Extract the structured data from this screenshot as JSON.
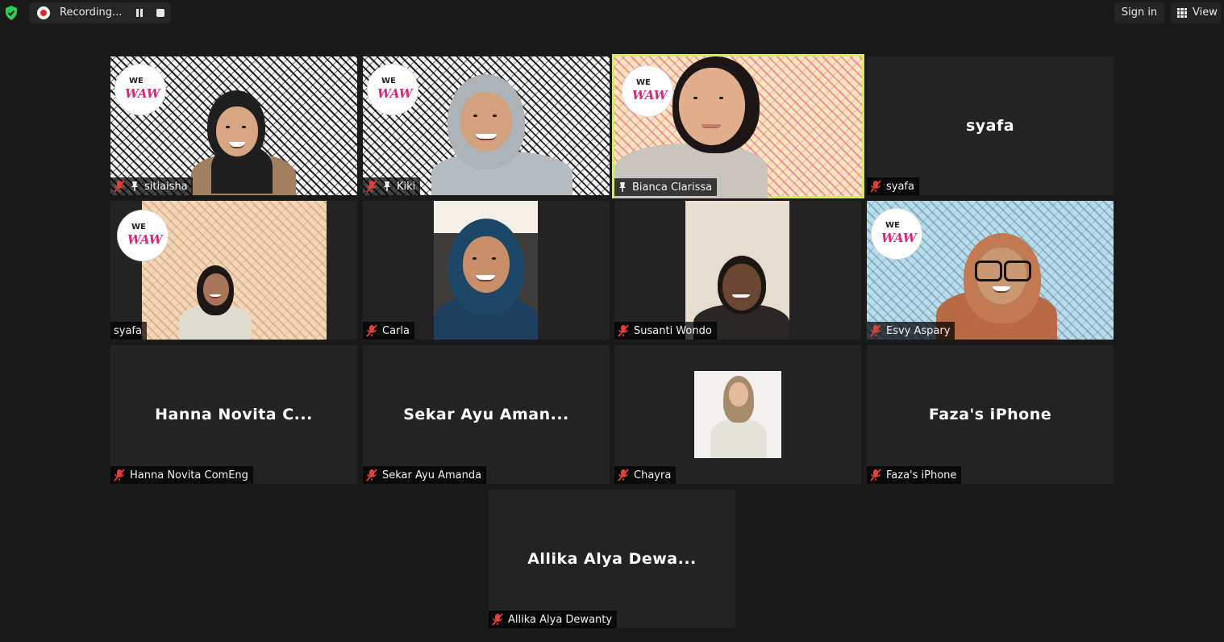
{
  "topbar": {
    "recording_label": "Recording...",
    "sign_in_label": "Sign in",
    "view_label": "View"
  },
  "participants": [
    {
      "tile_name": "sitiaisha",
      "muted": true,
      "pinned": true,
      "video": true,
      "background": "white-pattern"
    },
    {
      "tile_name": "Kiki",
      "muted": true,
      "pinned": true,
      "video": true,
      "background": "white-pattern"
    },
    {
      "tile_name": "Bianca Clarissa",
      "muted": false,
      "pinned": true,
      "video": true,
      "active_speaker": true,
      "background": "pink-pattern"
    },
    {
      "tile_name": "syafa",
      "display_name": "syafa",
      "muted": true,
      "video": false
    },
    {
      "tile_name": "syafa",
      "muted": false,
      "video": true,
      "background": "peach-pattern"
    },
    {
      "tile_name": "Carla",
      "muted": true,
      "video": true
    },
    {
      "tile_name": "Susanti Wondo",
      "muted": true,
      "video": true
    },
    {
      "tile_name": "Esvy Aspary",
      "muted": true,
      "video": true,
      "background": "blue-pattern"
    },
    {
      "tile_name": "Hanna Novita ComEng",
      "display_name": "Hanna Novita C...",
      "muted": true,
      "video": false
    },
    {
      "tile_name": "Sekar Ayu Amanda",
      "display_name": "Sekar Ayu Aman...",
      "muted": true,
      "video": false
    },
    {
      "tile_name": "Chayra",
      "muted": true,
      "video": false,
      "profile_photo": true
    },
    {
      "tile_name": "Faza's iPhone",
      "display_name": "Faza's iPhone",
      "muted": true,
      "video": false
    },
    {
      "tile_name": "Allika Alya Dewanty",
      "display_name": "Allika Alya Dewa...",
      "muted": true,
      "video": false
    }
  ],
  "logo": {
    "line1": "WE",
    "line2": "WAW"
  },
  "colors": {
    "background": "#1a1a1a",
    "tile": "#232323",
    "active_speaker_border": "#d7f046",
    "muted_icon": "#e0403a",
    "recording_dot": "#e02828",
    "shield": "#2ecc55"
  }
}
